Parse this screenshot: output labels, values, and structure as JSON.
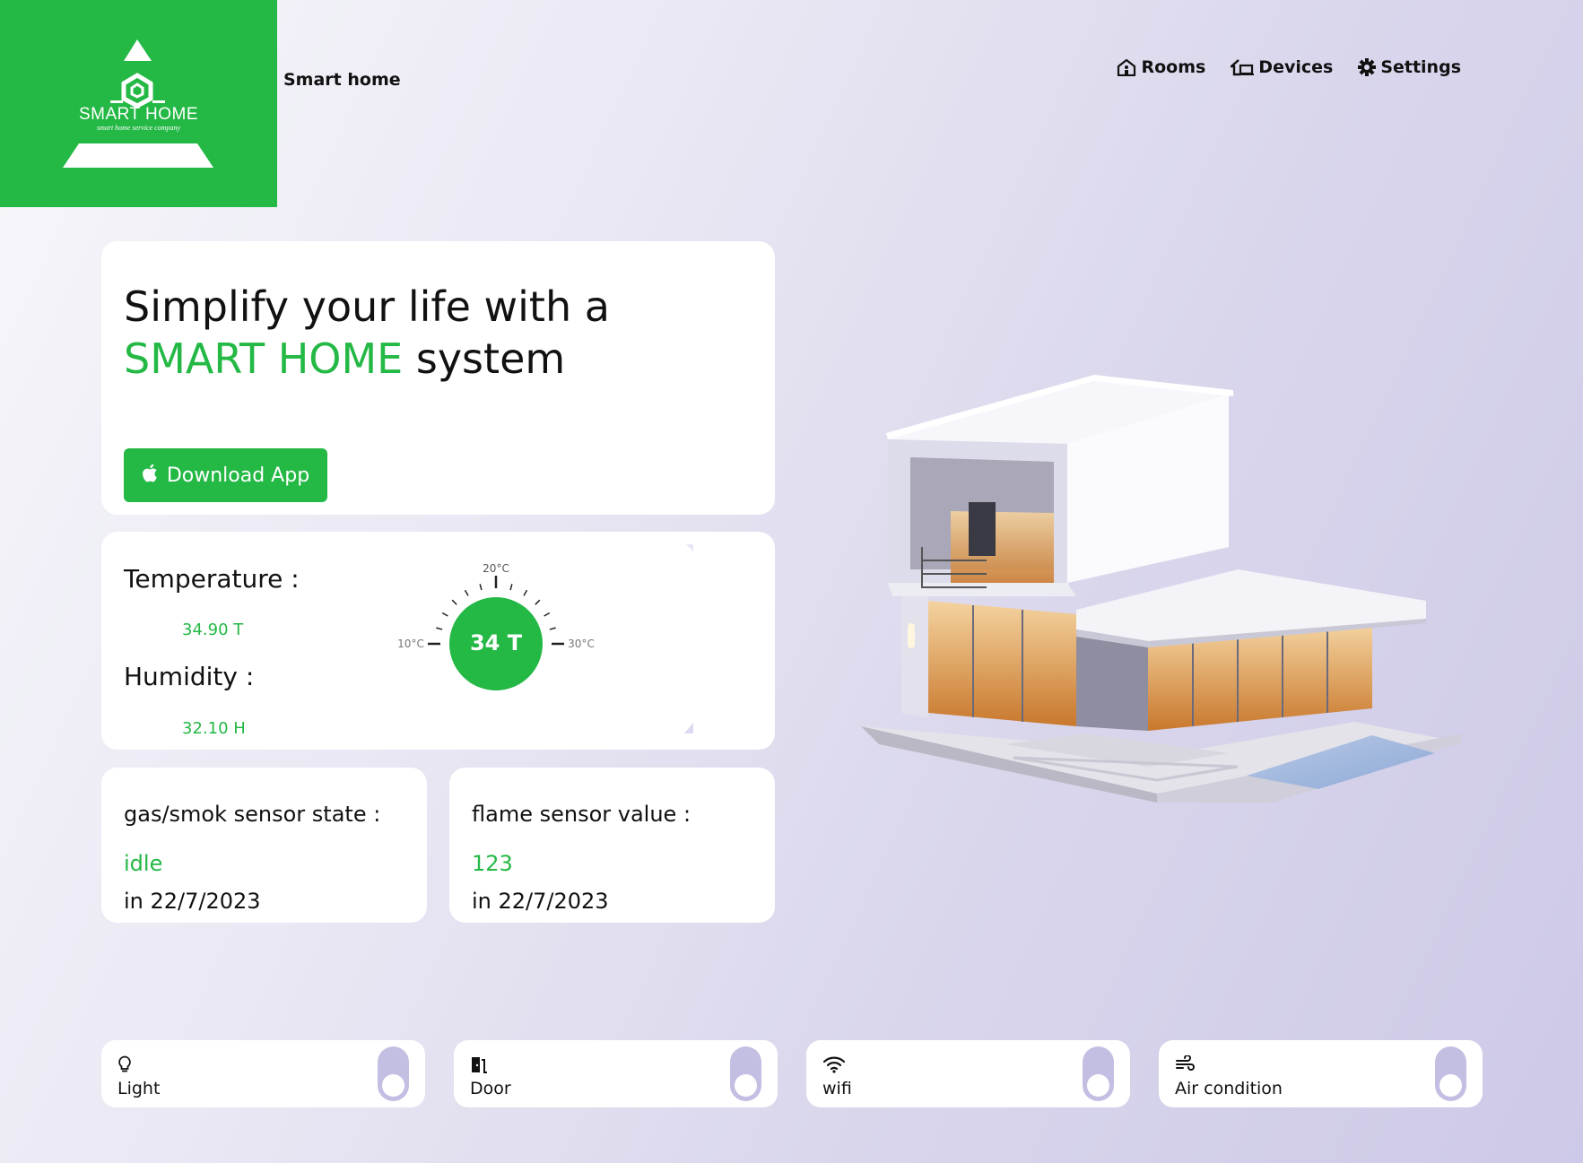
{
  "logo": {
    "name": "SMART HOME",
    "tagline": "smart home service company"
  },
  "brand": {
    "title": "Smart home"
  },
  "nav": [
    {
      "label": "Rooms",
      "icon": "house-user-icon"
    },
    {
      "label": "Devices",
      "icon": "devices-icon"
    },
    {
      "label": "Settings",
      "icon": "gear-icon"
    }
  ],
  "hero": {
    "line1": "Simplify your life with a",
    "highlight": "SMART HOME",
    "line2_rest": " system",
    "button": "Download App",
    "button_icon": "apple-icon"
  },
  "climate": {
    "temperature_label": "Temperature :",
    "temperature_value": "34.90 T",
    "humidity_label": "Humidity :",
    "humidity_value": "32.10 H",
    "gauge": {
      "display": "34 T",
      "min_label": "10°C",
      "mid_label": "20°C",
      "max_label": "30°C"
    }
  },
  "sensors": [
    {
      "title": "gas/smok sensor state :",
      "state": "idle",
      "date": "in 22/7/2023"
    },
    {
      "title": "flame sensor value :",
      "state": "123",
      "date": "in 22/7/2023"
    }
  ],
  "toggles": [
    {
      "label": "Light",
      "icon": "lightbulb-icon",
      "on": false
    },
    {
      "label": "Door",
      "icon": "door-icon",
      "on": false
    },
    {
      "label": "wifi",
      "icon": "wifi-icon",
      "on": false
    },
    {
      "label": "Air condition",
      "icon": "wind-icon",
      "on": false
    }
  ],
  "colors": {
    "accent": "#24b845",
    "toggle": "#c3bfe3",
    "card": "#ffffff"
  }
}
